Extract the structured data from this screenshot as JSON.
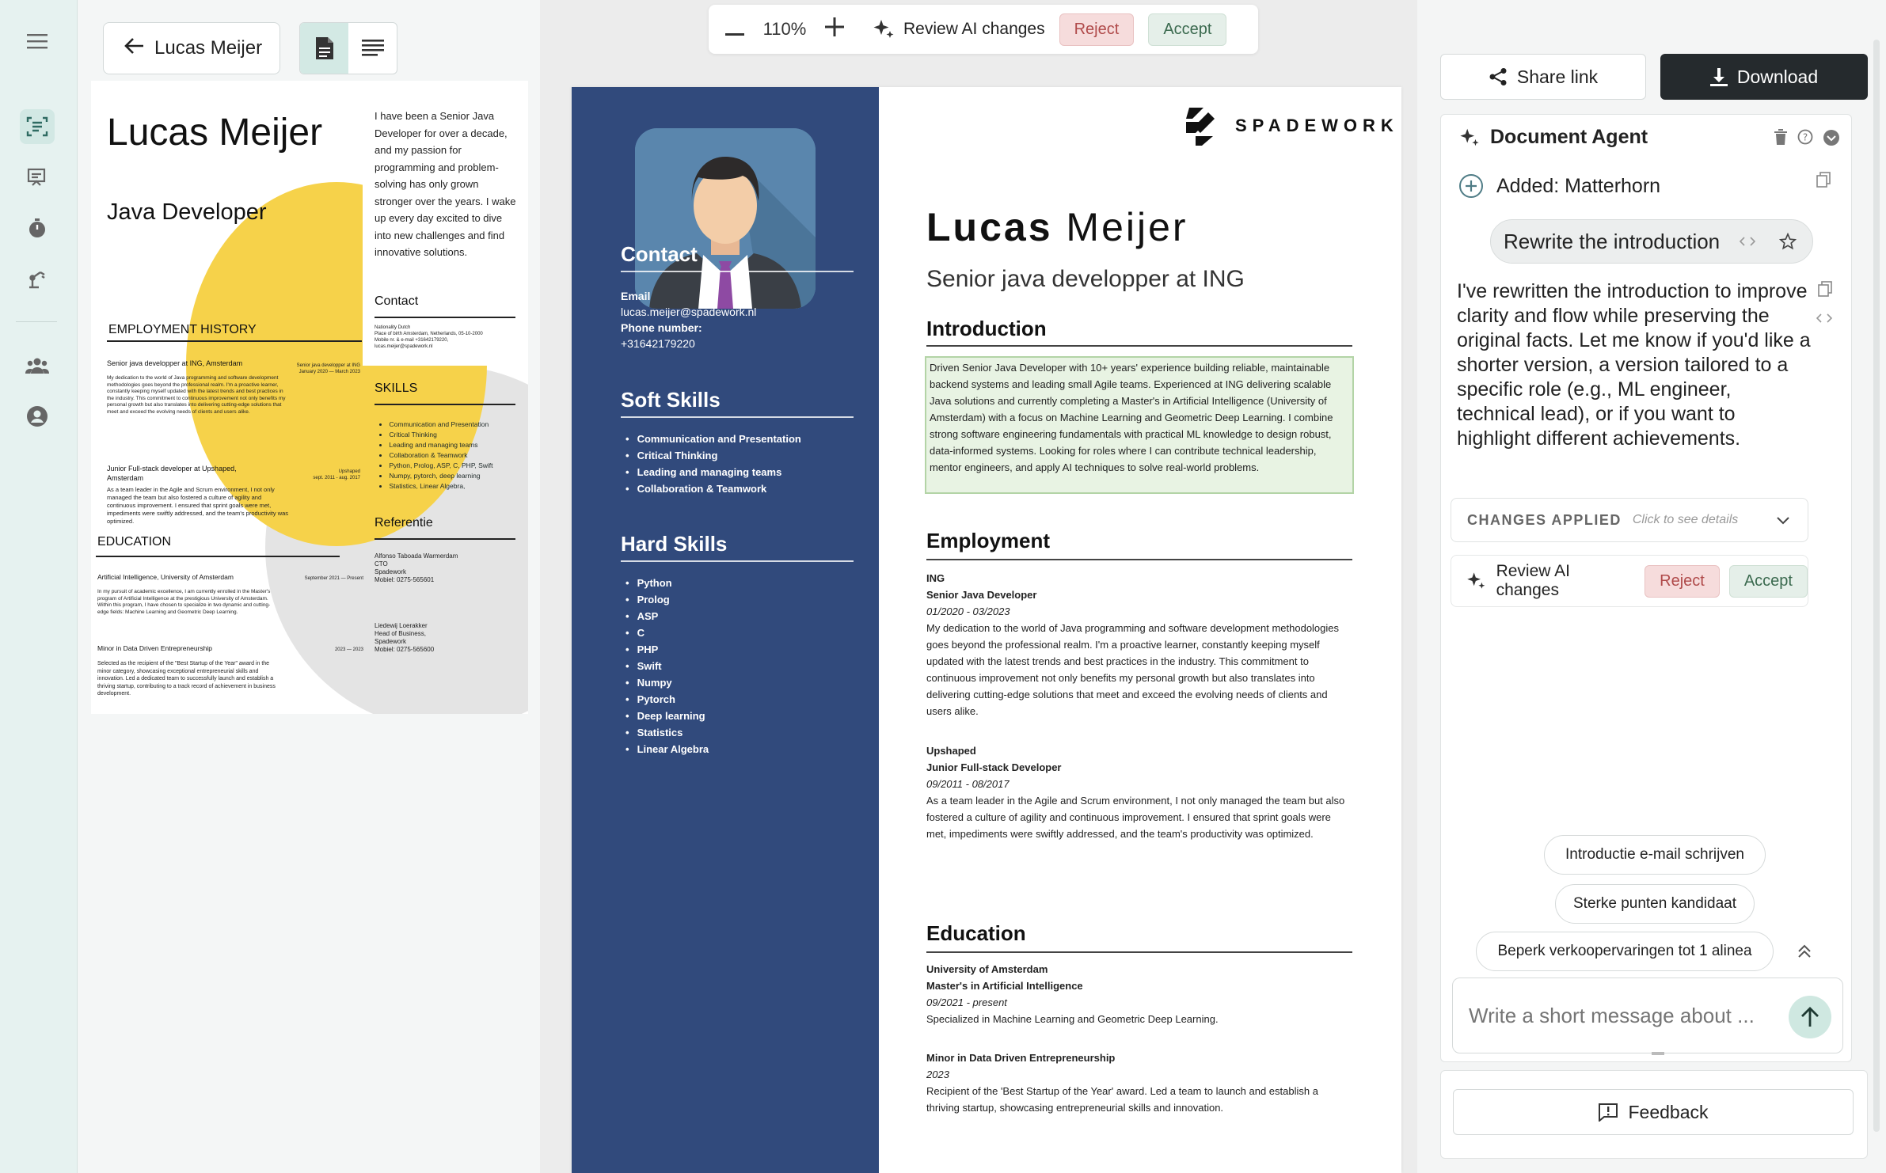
{
  "toolbar": {
    "back_label": "Lucas Meijer",
    "zoom_level": "110%",
    "review_label": "Review AI changes",
    "reject_label": "Reject",
    "accept_label": "Accept"
  },
  "thumbnail": {
    "name": "Lucas Meijer",
    "role": "Java Developer",
    "intro": "I have been a Senior Java Developer for over a decade, and my passion for programming and problem-solving has only grown stronger over the years. I wake up every day excited to dive into new challenges and find innovative solutions.",
    "employment_heading": "EMPLOYMENT HISTORY",
    "job1_title": "Senior java developper at ING, Amsterdam",
    "job1_dates": "Senior java developper at ING\nJanuary 2020 — March 2023",
    "job1_text": "My dedication to the world of Java programming and software development methodologies goes beyond the professional realm. I'm a proactive learner, constantly keeping myself updated with the latest trends and best practices in the industry. This commitment to continuous improvement not only benefits my personal growth but also translates into delivering cutting-edge solutions that meet and exceed the evolving needs of clients and users alike.",
    "job2_title": "Junior Full-stack developer at Upshaped, Amsterdam",
    "job2_dates": "Upshaped\nsept. 2011 - aug. 2017",
    "job2_text": "As a team leader in the Agile and Scrum environment, I not only managed the team but also fostered a culture of agility and continuous improvement. I ensured that sprint goals were met, impediments were swiftly addressed, and the team's productivity was optimized.",
    "education_heading": "EDUCATION",
    "edu1_title": "Artificial Intelligence, University of Amsterdam",
    "edu1_dates": "September 2021 — Present",
    "edu1_text": "In my pursuit of academic excellence, I am currently enrolled in the Master's program of Artificial Intelligence at the prestigious University of Amsterdam. Within this program, I have chosen to specialize in two dynamic and cutting-edge fields: Machine Learning and Geometric Deep Learning.",
    "edu2_title": "Minor in Data Driven Entrepreneurship",
    "edu2_dates": "2023 — 2023",
    "edu2_text": "Selected as the recipient of the \"Best Startup of the Year\" award in the minor category, showcasing exceptional entrepreneurial skills and innovation. Led a dedicated team to successfully launch and establish a thriving startup, contributing to a track record of achievement in business development.",
    "contact_heading": "Contact",
    "contact_text": "Nationality Dutch\nPlace of birth Amsterdam, Netherlands, 05-10-2000\nMobile nr. & e-mail +31642179220, lucas.meijer@spadework.nl",
    "skills_heading": "SKILLS",
    "skills": [
      "Communication and Presentation",
      "Critical Thinking",
      "Leading and managing teams",
      "Collaboration & Teamwork",
      "Python, Prolog, ASP, C, PHP, Swift",
      "Numpy, pytorch, deep learning",
      "Statistics, Linear Algebra,"
    ],
    "ref_heading": "Referentie",
    "ref1": "Alfonso Taboada Warmerdam\nCTO\nSpadework\nMobiel: 0275-565601",
    "ref2": "Liedewij Loerakker\nHead of Business,\nSpadework\nMobiel: 0275-565600"
  },
  "cv": {
    "logo": "SPADEWORK",
    "first_name": "Lucas",
    "last_name": "Meijer",
    "role": "Senior java developper at ING",
    "contact_heading": "Contact",
    "email_label": "Email",
    "email": "lucas.meijer@spadework.nl",
    "phone_label": "Phone number:",
    "phone": "+31642179220",
    "soft_heading": "Soft Skills",
    "soft_skills": [
      "Communication and Presentation",
      "Critical Thinking",
      "Leading and managing teams",
      "Collaboration & Teamwork"
    ],
    "hard_heading": "Hard Skills",
    "hard_skills": [
      "Python",
      "Prolog",
      "ASP",
      "C",
      "PHP",
      "Swift",
      "Numpy",
      "Pytorch",
      "Deep learning",
      "Statistics",
      "Linear Algebra"
    ],
    "intro_heading": "Introduction",
    "intro": "Driven Senior Java Developer with 10+ years' experience building reliable, maintainable backend systems and leading small Agile teams. Experienced at ING delivering scalable Java solutions and currently completing a Master's in Artificial Intelligence (University of Amsterdam) with a focus on Machine Learning and Geometric Deep Learning. I combine strong software engineering fundamentals with practical ML knowledge to design robust, data-informed systems. Looking for roles where I can contribute technical leadership, mentor engineers, and apply AI techniques to solve real-world problems.",
    "employment_heading": "Employment",
    "job1_company": "ING",
    "job1_title": "Senior Java Developer",
    "job1_dates": "01/2020 - 03/2023",
    "job1_text": "My dedication to the world of Java programming and software development methodologies goes beyond the professional realm. I'm a proactive learner, constantly keeping myself updated with the latest trends and best practices in the industry. This commitment to continuous improvement not only benefits my personal growth but also translates into delivering cutting-edge solutions that meet and exceed the evolving needs of clients and users alike.",
    "job2_company": "Upshaped",
    "job2_title": "Junior Full-stack Developer",
    "job2_dates": "09/2011 - 08/2017",
    "job2_text": "As a team leader in the Agile and Scrum environment, I not only managed the team but also fostered a culture of agility and continuous improvement. I ensured that sprint goals were met, impediments were swiftly addressed, and the team's productivity was optimized.",
    "education_heading": "Education",
    "edu1_school": "University of Amsterdam",
    "edu1_title": "Master's in Artificial Intelligence",
    "edu1_dates": "09/2021 - present",
    "edu1_text": "Specialized in Machine Learning and Geometric Deep Learning.",
    "edu2_title": "Minor in Data Driven Entrepreneurship",
    "edu2_dates": "2023",
    "edu2_text": "Recipient of the 'Best Startup of the Year' award. Led a team to launch and establish a thriving startup, showcasing entrepreneurial skills and innovation."
  },
  "right": {
    "share_label": "Share link",
    "download_label": "Download",
    "agent_title": "Document Agent",
    "added_label": "Added: Matterhorn",
    "user_message": "Rewrite the introduction",
    "ai_message": "I've rewritten the introduction to improve clarity and flow while preserving the original facts. Let me know if you'd like a shorter version, a version tailored to a specific role (e.g., ML engineer, technical lead), or if you want to highlight different achievements.",
    "changes_label": "CHANGES APPLIED",
    "changes_hint": "Click to see details",
    "review_label": "Review AI changes",
    "reject_label": "Reject",
    "accept_label": "Accept",
    "suggestions": [
      "Introductie e-mail schrijven",
      "Sterke punten kandidaat",
      "Beperk verkoopervaringen tot 1 alinea"
    ],
    "composer_placeholder": "Write a short message about ...",
    "feedback_label": "Feedback"
  },
  "colors": {
    "cv_sidebar": "#314a7c",
    "accent_green": "#cfe8e1",
    "dark_button": "#252a2d",
    "reject_bg": "#f6dcdc",
    "accept_bg": "#e5efe9",
    "thumb_yellow": "#f6d24a"
  }
}
